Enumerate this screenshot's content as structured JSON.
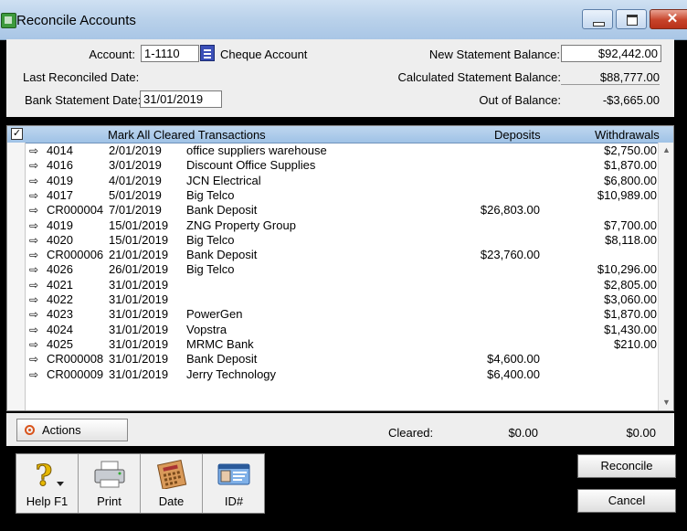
{
  "window": {
    "title": "Reconcile Accounts"
  },
  "header": {
    "account_label": "Account:",
    "account_code": "1-1110",
    "account_name": "Cheque Account",
    "last_reconciled_label": "Last Reconciled Date:",
    "last_reconciled_value": "",
    "bank_statement_date_label": "Bank Statement Date:",
    "bank_statement_date": "31/01/2019",
    "new_statement_balance_label": "New Statement Balance:",
    "new_statement_balance": "$92,442.00",
    "calculated_statement_balance_label": "Calculated Statement Balance:",
    "calculated_statement_balance": "$88,777.00",
    "out_of_balance_label": "Out of Balance:",
    "out_of_balance": "-$3,665.00"
  },
  "grid": {
    "header": {
      "mark_all": "Mark All Cleared Transactions",
      "deposits": "Deposits",
      "withdrawals": "Withdrawals"
    },
    "rows": [
      {
        "id": "4014",
        "date": "2/01/2019",
        "memo": "office suppliers warehouse",
        "deposit": "",
        "withdrawal": "$2,750.00"
      },
      {
        "id": "4016",
        "date": "3/01/2019",
        "memo": "Discount Office Supplies",
        "deposit": "",
        "withdrawal": "$1,870.00"
      },
      {
        "id": "4019",
        "date": "4/01/2019",
        "memo": "JCN Electrical",
        "deposit": "",
        "withdrawal": "$6,800.00"
      },
      {
        "id": "4017",
        "date": "5/01/2019",
        "memo": "Big Telco",
        "deposit": "",
        "withdrawal": "$10,989.00"
      },
      {
        "id": "CR000004",
        "date": "7/01/2019",
        "memo": "Bank Deposit",
        "deposit": "$26,803.00",
        "withdrawal": ""
      },
      {
        "id": "4019",
        "date": "15/01/2019",
        "memo": "ZNG Property Group",
        "deposit": "",
        "withdrawal": "$7,700.00"
      },
      {
        "id": "4020",
        "date": "15/01/2019",
        "memo": "Big Telco",
        "deposit": "",
        "withdrawal": "$8,118.00"
      },
      {
        "id": "CR000006",
        "date": "21/01/2019",
        "memo": "Bank Deposit",
        "deposit": "$23,760.00",
        "withdrawal": ""
      },
      {
        "id": "4026",
        "date": "26/01/2019",
        "memo": "Big Telco",
        "deposit": "",
        "withdrawal": "$10,296.00"
      },
      {
        "id": "4021",
        "date": "31/01/2019",
        "memo": "",
        "deposit": "",
        "withdrawal": "$2,805.00"
      },
      {
        "id": "4022",
        "date": "31/01/2019",
        "memo": "",
        "deposit": "",
        "withdrawal": "$3,060.00"
      },
      {
        "id": "4023",
        "date": "31/01/2019",
        "memo": "PowerGen",
        "deposit": "",
        "withdrawal": "$1,870.00"
      },
      {
        "id": "4024",
        "date": "31/01/2019",
        "memo": "Vopstra",
        "deposit": "",
        "withdrawal": "$1,430.00"
      },
      {
        "id": "4025",
        "date": "31/01/2019",
        "memo": "MRMC Bank",
        "deposit": "",
        "withdrawal": "$210.00"
      },
      {
        "id": "CR000008",
        "date": "31/01/2019",
        "memo": "Bank Deposit",
        "deposit": "$4,600.00",
        "withdrawal": ""
      },
      {
        "id": "CR000009",
        "date": "31/01/2019",
        "memo": "Jerry Technology",
        "deposit": "$6,400.00",
        "withdrawal": ""
      }
    ]
  },
  "footer": {
    "actions_label": "Actions",
    "cleared_label": "Cleared:",
    "cleared_deposits": "$0.00",
    "cleared_withdrawals": "$0.00"
  },
  "toolbar": {
    "help_label": "Help F1",
    "print_label": "Print",
    "date_label": "Date",
    "id_label": "ID#"
  },
  "buttons": {
    "reconcile_label": "Reconcile",
    "cancel_label": "Cancel"
  },
  "icons": {
    "row_arrow": "⇨",
    "checkbox_mark": "☑"
  },
  "colors": {
    "titlebar": "#b9d1ea",
    "grid_header": "#9fc2e6",
    "close_button": "#c7432a",
    "panel": "#eeeeee"
  }
}
